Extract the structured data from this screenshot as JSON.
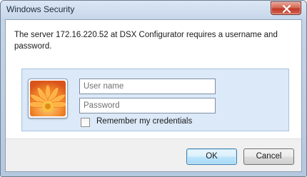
{
  "window": {
    "title": "Windows Security",
    "close_icon": "close-icon"
  },
  "message": "The server 172.16.220.52 at DSX Configurator requires a username and password.",
  "credentials": {
    "user_tile_icon": "flower-user-tile-icon",
    "username": {
      "placeholder": "User name",
      "value": ""
    },
    "password": {
      "placeholder": "Password",
      "value": ""
    },
    "remember_label": "Remember my credentials",
    "remember_checked": false
  },
  "buttons": {
    "ok_label": "OK",
    "cancel_label": "Cancel"
  },
  "colors": {
    "panel": "#dbe9f8",
    "close_button": "#c0392b",
    "ok_border": "#3c7fb1",
    "footer": "#f0f0f0"
  }
}
